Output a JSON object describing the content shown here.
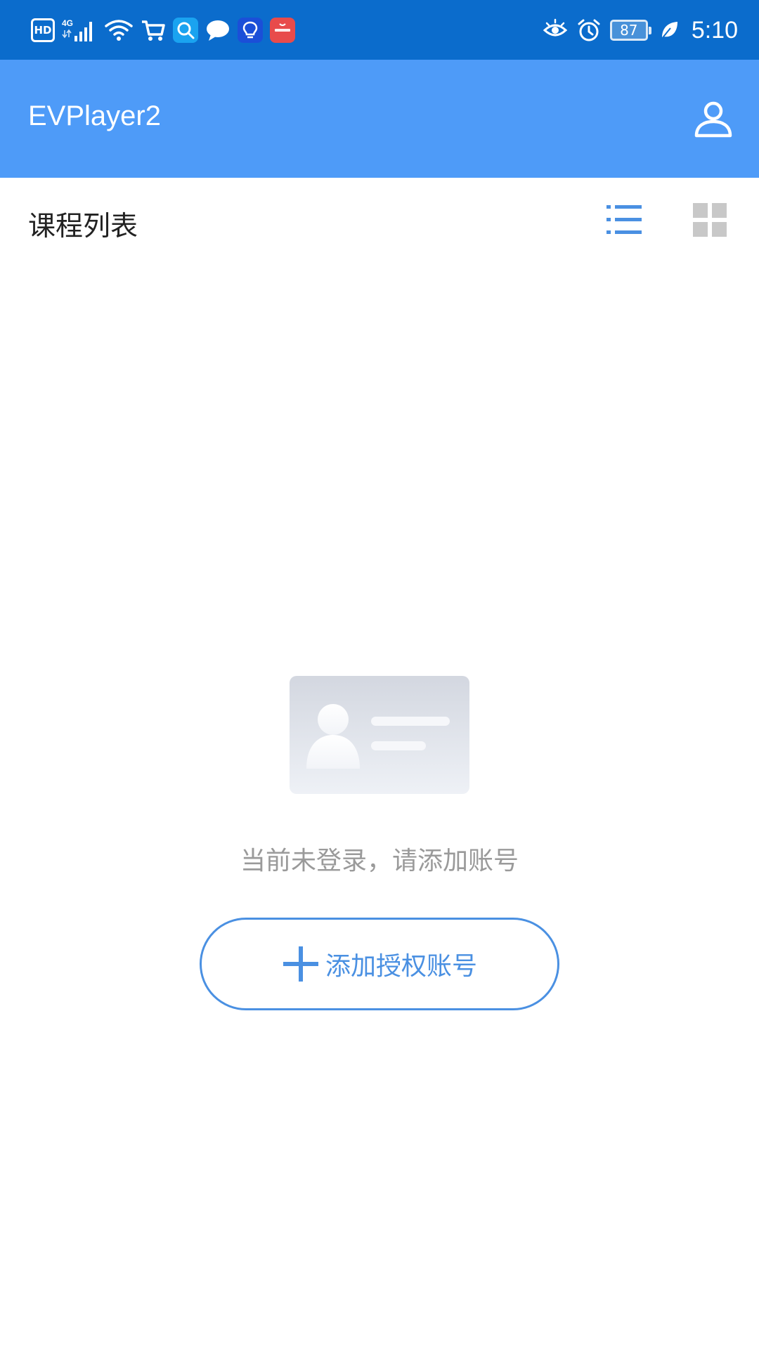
{
  "status_bar": {
    "hd_badge": "HD",
    "network": "4G",
    "battery_level": "87",
    "time": "5:10",
    "left_icons": [
      "hd-icon",
      "signal-icon",
      "wifi-icon",
      "shopping-cart-icon",
      "search-app-icon",
      "chat-bubble-icon",
      "lightbulb-icon",
      "huawei-app-icon"
    ],
    "right_icons": [
      "eye-comfort-icon",
      "alarm-icon",
      "battery-icon",
      "leaf-icon"
    ]
  },
  "app_bar": {
    "title": "EVPlayer2",
    "account_icon": "user-icon"
  },
  "list_header": {
    "title": "课程列表",
    "list_view_icon": "list-view-icon",
    "grid_view_icon": "grid-view-icon"
  },
  "empty_state": {
    "illustration": "id-card-icon",
    "message": "当前未登录，请添加账号",
    "add_button_label": "添加授权账号",
    "add_button_icon": "plus-icon"
  },
  "colors": {
    "status_bar": "#0b6ccc",
    "app_bar": "#4e9bf8",
    "accent": "#4a90e2",
    "inactive_icon": "#c8c8c8",
    "muted_text": "#9a9a9a"
  }
}
